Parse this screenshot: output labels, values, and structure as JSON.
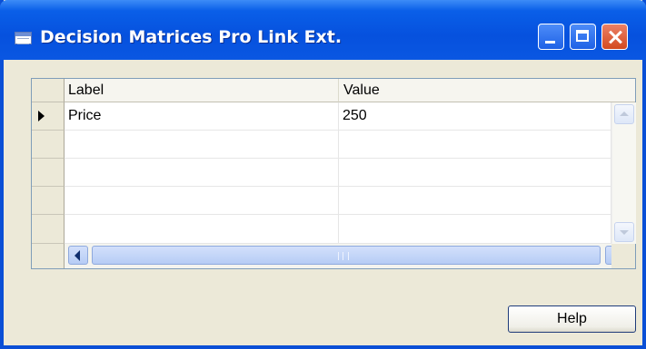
{
  "window": {
    "title": "Decision Matrices Pro Link Ext.",
    "icon": "table-window-icon",
    "accent": "#0a5fe8"
  },
  "grid": {
    "columns": [
      "Label",
      "Value"
    ],
    "rows": [
      {
        "label": "Price",
        "value": "250",
        "selected": true
      },
      {
        "label": "",
        "value": ""
      },
      {
        "label": "",
        "value": ""
      },
      {
        "label": "",
        "value": ""
      },
      {
        "label": "",
        "value": ""
      }
    ]
  },
  "buttons": {
    "help": "Help"
  }
}
